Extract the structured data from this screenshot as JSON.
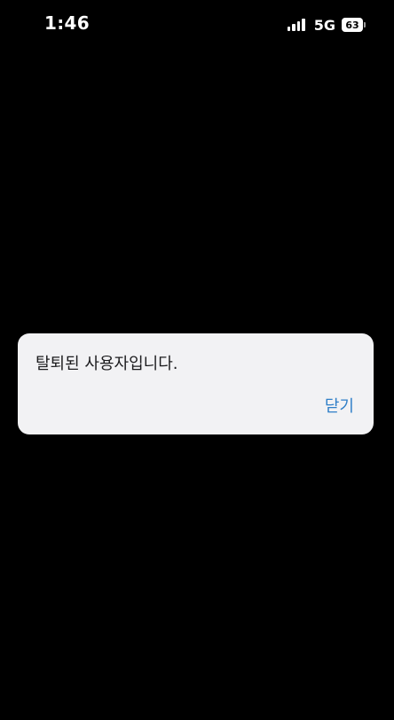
{
  "status_bar": {
    "time": "1:46",
    "network": "5G",
    "battery_level": "63",
    "signal_icon": "cellular-signal-icon",
    "battery_icon": "battery-icon"
  },
  "alert": {
    "message": "탈퇴된 사용자입니다.",
    "close_label": "닫기"
  },
  "colors": {
    "background": "#000000",
    "alert_background": "#f2f2f4",
    "message_text": "#1c1c1e",
    "accent": "#2f7fc8"
  }
}
